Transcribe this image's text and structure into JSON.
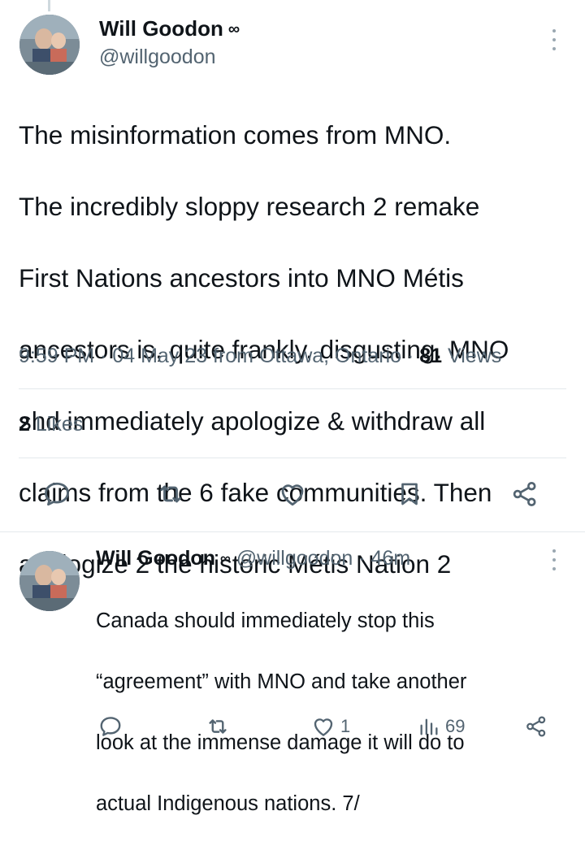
{
  "main_tweet": {
    "author_name": "Will Goodon",
    "author_badge": "∞",
    "author_handle": "@willgoodon",
    "text_lines": [
      "The misinformation comes from MNO.",
      "The incredibly sloppy research 2 remake",
      "First Nations ancestors into MNO Métis",
      "ancestors is, quite frankly, disgusting. MNO",
      "shd immediately apologize & withdraw all",
      "claims from the 6 fake communities. Then",
      "apologize 2 the historic Métis Nation 2"
    ],
    "timestamp": "9:59 PM · 04 May 23 from Ottawa, Ontario ·",
    "views_count": "81",
    "views_label": "Views",
    "likes_count": "2",
    "likes_label": "Likes"
  },
  "reply_tweet": {
    "author_name": "Will Goodon",
    "author_badge": "∞",
    "author_handle": "@willgoodon",
    "time_ago": "· 46m",
    "text_lines": [
      "Canada should immediately stop this",
      "“agreement” with MNO and take another",
      "look at the immense damage it will do to",
      "actual Indigenous nations. 7/"
    ],
    "like_count": "1",
    "view_count": "69"
  },
  "icons": {
    "reply": "reply-icon",
    "retweet": "retweet-icon",
    "like": "heart-icon",
    "bookmark": "bookmark-icon",
    "share": "share-icon",
    "views": "analytics-icon",
    "more": "more-icon"
  },
  "colors": {
    "text_primary": "#0f1419",
    "text_secondary": "#536471",
    "divider": "#e4e9ec",
    "icon": "#536471"
  }
}
